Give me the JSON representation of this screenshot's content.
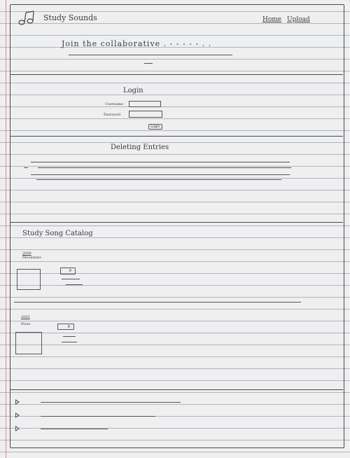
{
  "header": {
    "brand": "Study Sounds",
    "logo_icon": "music-note-icon",
    "nav": [
      {
        "label": "Home"
      },
      {
        "label": "Upload"
      }
    ]
  },
  "hero": {
    "title": "Join the collaborative . - - - - - . ."
  },
  "login": {
    "title": "Login",
    "username_label": "Username",
    "password_label": "Password",
    "submit_label": "Login"
  },
  "deleting": {
    "title": "Deleting Entries"
  },
  "catalog": {
    "title": "Study Song Catalog",
    "items": [
      {
        "year": "2009",
        "artist": "Mountains"
      },
      {
        "year": "2003",
        "artist": "Poise"
      }
    ]
  },
  "player": {
    "play_icon": "play-icon"
  }
}
